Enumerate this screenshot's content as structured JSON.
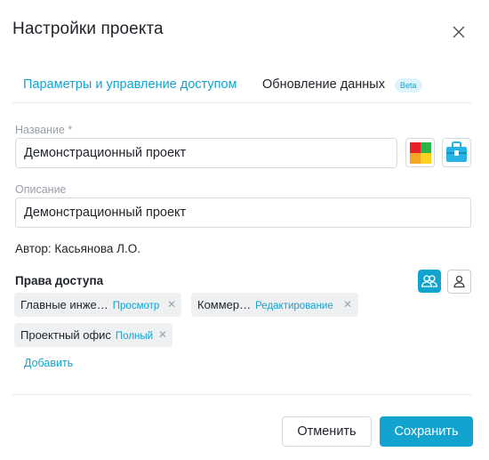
{
  "dialog": {
    "title": "Настройки проекта",
    "close_icon": "close-icon"
  },
  "tabs": [
    {
      "label": "Параметры и управление доступом",
      "active": true
    },
    {
      "label": "Обновление данных",
      "active": false,
      "badge": "Beta"
    }
  ],
  "name_field": {
    "label": "Название",
    "required_mark": "*",
    "value": "Демонстрационный проект"
  },
  "color_picker": {
    "icon": "color-squares-icon",
    "colors": [
      "#e8202a",
      "#2cb34a",
      "#f5a623",
      "#ffd21f"
    ]
  },
  "icon_picker": {
    "icon": "briefcase-icon",
    "color": "#27b3e3"
  },
  "description_field": {
    "label": "Описание",
    "value": "Демонстрационный проект"
  },
  "author": "Автор: Касьянова Л.О.",
  "access": {
    "title": "Права доступа",
    "view_toggle": [
      {
        "icon": "users-group-icon",
        "active": true
      },
      {
        "icon": "user-icon",
        "active": false
      }
    ],
    "entries": [
      {
        "name": "Главные инже…",
        "role": "Просмотр"
      },
      {
        "name": "Коммер…",
        "role": "Редактирование"
      },
      {
        "name": "Проектный офис",
        "role": "Полный"
      }
    ],
    "add_label": "Добавить"
  },
  "footer": {
    "cancel_label": "Отменить",
    "save_label": "Сохранить"
  },
  "colors": {
    "accent": "#13a3cf",
    "text": "#1f2329",
    "muted": "#9aa0a8",
    "chip_bg": "#eef0f2"
  }
}
